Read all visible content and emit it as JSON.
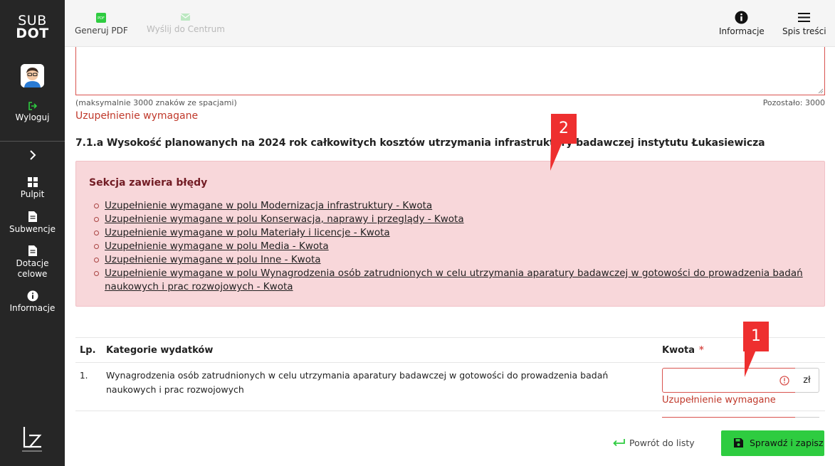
{
  "sidebar": {
    "logo_line1": "SUB",
    "logo_line2": "DOT",
    "logout_label": "Wyloguj",
    "items": [
      {
        "label": "Pulpit",
        "icon": "grid-icon"
      },
      {
        "label": "Subwencje",
        "icon": "document-icon"
      },
      {
        "label": "Dotacje celowe",
        "icon": "document-icon"
      },
      {
        "label": "Informacje",
        "icon": "info-icon"
      }
    ],
    "bottom_logo_text": "Łukasiewicz"
  },
  "toolbar": {
    "pdf_label": "Generuj PDF",
    "send_label": "Wyślij do Centrum",
    "info_label": "Informacje",
    "toc_label": "Spis treści"
  },
  "form": {
    "textarea_hint": "(maksymalnie 3000 znaków ze spacjami)",
    "remaining": "Pozostało: 3000",
    "required_msg": "Uzupełnienie wymagane",
    "section_title": "7.1.a Wysokość planowanych na 2024 rok całkowitych kosztów utrzymania infrastruktury badawczej instytutu Łukasiewicza"
  },
  "errors": {
    "title": "Sekcja zawiera błędy",
    "items": [
      "Uzupełnienie wymagane w polu Modernizacja infrastruktury - Kwota",
      "Uzupełnienie wymagane w polu Konserwacja, naprawy i przeglądy - Kwota",
      "Uzupełnienie wymagane w polu Materiały i licencje - Kwota",
      "Uzupełnienie wymagane w polu Media - Kwota",
      "Uzupełnienie wymagane w polu Inne - Kwota",
      "Uzupełnienie wymagane w polu Wynagrodzenia osób zatrudnionych w celu utrzymania aparatury badawczej w gotowości do prowadzenia badań naukowych i prac rozwojowych - Kwota"
    ]
  },
  "table": {
    "col_lp": "Lp.",
    "col_category": "Kategorie wydatków",
    "col_amount": "Kwota",
    "required_star": "*",
    "rows": [
      {
        "lp": "1.",
        "category": "Wynagrodzenia osób zatrudnionych w celu utrzymania aparatury badawczej w gotowości do prowadzenia badań naukowych i prac rozwojowych",
        "amount": "",
        "unit": "zł",
        "error": "Uzupełnienie wymagane"
      }
    ]
  },
  "footer": {
    "back_label": "Powrót do listy",
    "save_label": "Sprawdź i zapisz"
  },
  "callouts": {
    "first": "1",
    "second": "2"
  },
  "colors": {
    "sidebar_bg": "#262626",
    "accent_green": "#2ecc40",
    "error_red": "#d9534f",
    "error_box_bg": "#f8d7da",
    "callout_red": "#ee2f2f"
  }
}
